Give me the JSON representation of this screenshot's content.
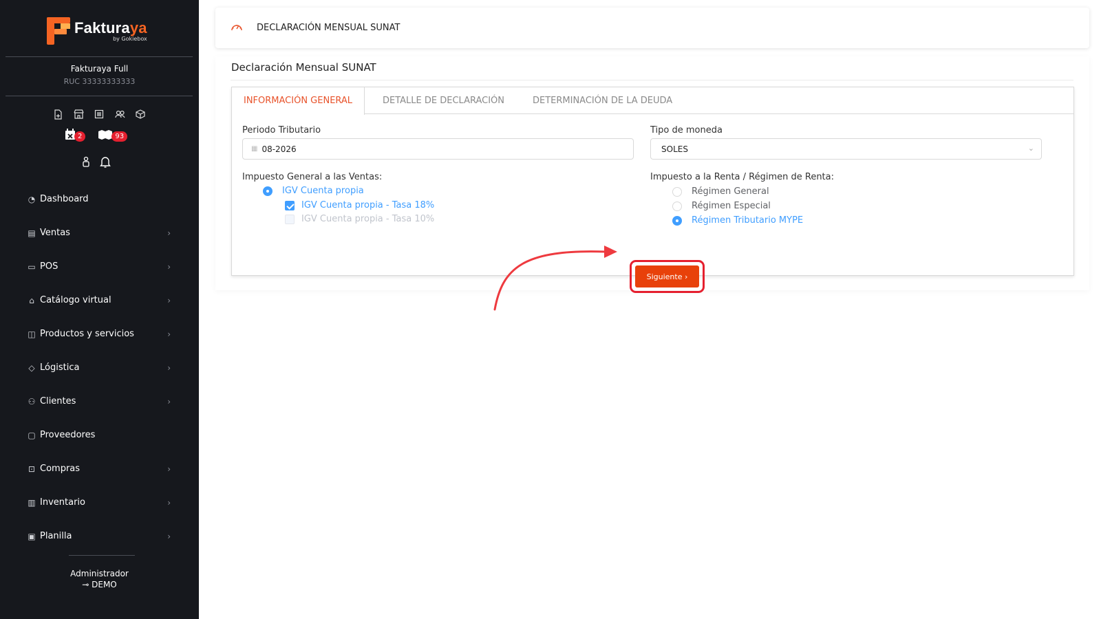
{
  "brand": {
    "name_main": "Faktura",
    "name_accent": "ya",
    "byline": "by Gokiebox"
  },
  "company": {
    "name": "Fakturaya Full",
    "ruc": "RUC 33333333333"
  },
  "quick_icons": [
    "file-add-icon",
    "store-icon",
    "receipt-icon",
    "users-icon",
    "box-icon"
  ],
  "badges": [
    {
      "icon": "calendar-x-icon",
      "count": "2"
    },
    {
      "icon": "boxes-icon",
      "count": "93"
    }
  ],
  "nav": {
    "items": [
      {
        "label": "Dashboard",
        "icon": "dashboard-icon",
        "chevron": false
      },
      {
        "label": "Ventas",
        "icon": "sales-icon",
        "chevron": true
      },
      {
        "label": "POS",
        "icon": "monitor-icon",
        "chevron": true
      },
      {
        "label": "Catálogo virtual",
        "icon": "store-icon",
        "chevron": true
      },
      {
        "label": "Productos y servicios",
        "icon": "box-icon",
        "chevron": true
      },
      {
        "label": "Lógistica",
        "icon": "tag-icon",
        "chevron": true
      },
      {
        "label": "Clientes",
        "icon": "users-icon",
        "chevron": true
      },
      {
        "label": "Proveedores",
        "icon": "briefcase-icon",
        "chevron": false
      },
      {
        "label": "Compras",
        "icon": "bag-icon",
        "chevron": true
      },
      {
        "label": "Inventario",
        "icon": "book-icon",
        "chevron": true
      },
      {
        "label": "Planilla",
        "icon": "id-card-icon",
        "chevron": true
      }
    ]
  },
  "user": {
    "role": "Administrador",
    "name": "DEMO"
  },
  "header": {
    "title": "DECLARACIÓN MENSUAL SUNAT"
  },
  "card": {
    "title": "Declaración Mensual SUNAT"
  },
  "tabs": [
    {
      "label": "INFORMACIÓN GENERAL",
      "active": true
    },
    {
      "label": "DETALLE DE DECLARACIÓN",
      "active": false
    },
    {
      "label": "DETERMINACIÓN DE LA DEUDA",
      "active": false
    }
  ],
  "form": {
    "periodo_label": "Periodo Tributario",
    "periodo_value": "08-2026",
    "moneda_label": "Tipo de moneda",
    "moneda_value": "SOLES",
    "igv_label": "Impuesto General a las Ventas:",
    "igv_radio": "IGV Cuenta propia",
    "igv_18": "IGV Cuenta propia - Tasa 18%",
    "igv_10": "IGV Cuenta propia - Tasa 10%",
    "renta_label": "Impuesto a la Renta / Régimen de Renta:",
    "renta_options": [
      "Régimen General",
      "Régimen Especial",
      "Régimen Tributario MYPE"
    ],
    "renta_selected": "Régimen Tributario MYPE",
    "next_button": "Siguiente"
  },
  "colors": {
    "sidebar_bg": "#16181d",
    "accent": "#e8532b",
    "button": "#e8410a",
    "highlight": "#e5202f",
    "selected": "#409eff"
  }
}
